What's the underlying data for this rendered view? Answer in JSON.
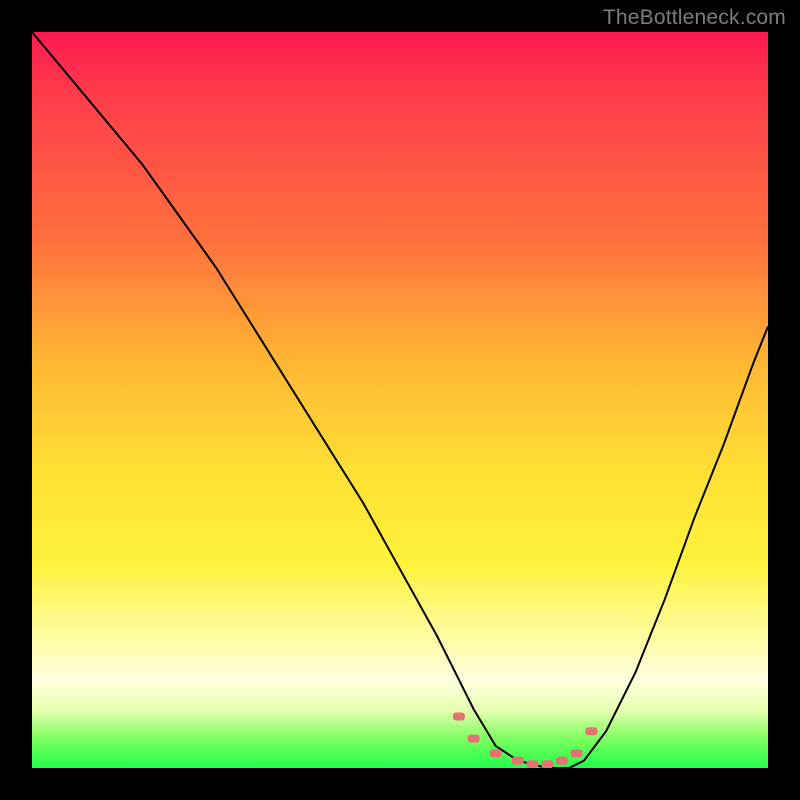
{
  "attribution": "TheBottleneck.com",
  "chart_data": {
    "type": "line",
    "title": "",
    "xlabel": "",
    "ylabel": "",
    "ylim": [
      0,
      100
    ],
    "description": "V-shaped bottleneck curve over a red-to-green gradient. Y≈100 at x=0 (top-left), drops to ≈0 at x≈63, stays ≈0 to x≈75, then rises to ≈60 at x=100.",
    "series": [
      {
        "name": "curve",
        "x": [
          0,
          5,
          10,
          15,
          20,
          25,
          30,
          35,
          40,
          45,
          50,
          55,
          58,
          60,
          63,
          66,
          70,
          73,
          75,
          78,
          82,
          86,
          90,
          94,
          98,
          100
        ],
        "values": [
          100,
          94,
          88,
          82,
          75,
          68,
          60,
          52,
          44,
          36,
          27,
          18,
          12,
          8,
          3,
          1,
          0,
          0,
          1,
          5,
          13,
          23,
          34,
          44,
          55,
          60
        ]
      }
    ],
    "gradient_stops": [
      {
        "pct": 0,
        "color": "#ff1a52"
      },
      {
        "pct": 50,
        "color": "#ffc934"
      },
      {
        "pct": 80,
        "color": "#fffca0"
      },
      {
        "pct": 100,
        "color": "#1eff4a"
      }
    ],
    "markers": {
      "note": "salmon dashed markers near trough",
      "x": [
        58,
        60,
        63,
        66,
        68,
        70,
        72,
        74,
        76
      ],
      "values": [
        7,
        4,
        2,
        1,
        0.5,
        0.5,
        1,
        2,
        5
      ]
    }
  }
}
